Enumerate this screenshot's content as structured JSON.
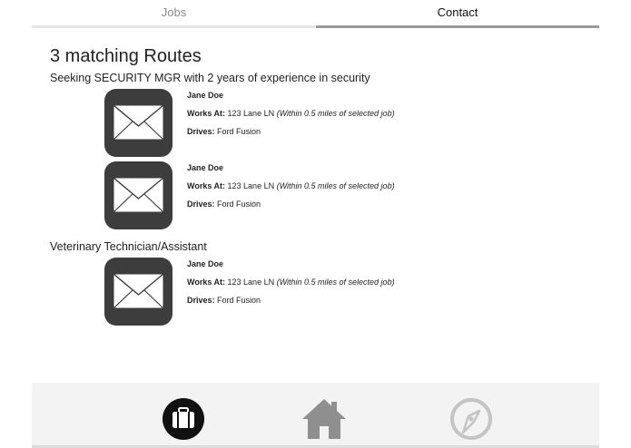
{
  "tabs": {
    "jobs_label": "Jobs",
    "contact_label": "Contact",
    "active": "Contact"
  },
  "main": {
    "heading": "3 matching Routes",
    "sections": [
      {
        "title": "Seeking SECURITY MGR with 2 years of experience in security",
        "routes": [
          {
            "name": "Jane Doe",
            "works_label": "Works At:",
            "works_value": "123 Lane LN",
            "distance_note": "(Within 0.5 miles of selected job)",
            "drives_label": "Drives:",
            "drives_value": "Ford Fusion",
            "icon": "mail-icon"
          },
          {
            "name": "Jane Doe",
            "works_label": "Works At:",
            "works_value": "123 Lane LN",
            "distance_note": "(Within 0.5 miles of selected job)",
            "drives_label": "Drives:",
            "drives_value": "Ford Fusion",
            "icon": "mail-icon"
          }
        ]
      },
      {
        "title": "Veterinary Technician/Assistant",
        "routes": [
          {
            "name": "Jane Doe",
            "works_label": "Works At:",
            "works_value": "123 Lane LN",
            "distance_note": "(Within 0.5 miles of selected job)",
            "drives_label": "Drives:",
            "drives_value": "Ford Fusion",
            "icon": "mail-icon"
          }
        ]
      }
    ]
  },
  "bottom_nav": {
    "items": [
      {
        "icon": "briefcase-icon",
        "active": true
      },
      {
        "icon": "home-icon",
        "active": false
      },
      {
        "icon": "compass-icon",
        "active": false
      }
    ]
  },
  "colors": {
    "tile": "#3d3d3d",
    "nav_active": "#111111",
    "nav_inactive": "#8f8f8f",
    "compass": "#c4c4c4",
    "tab_indicator": "#9a9a9a"
  }
}
